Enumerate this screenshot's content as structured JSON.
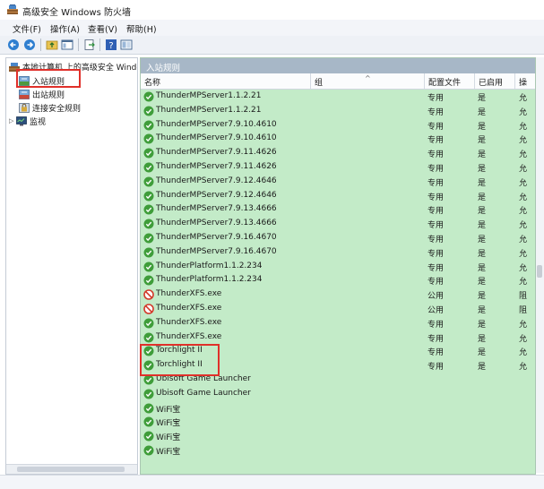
{
  "window": {
    "title": "高级安全 Windows 防火墙"
  },
  "menu": [
    "文件(F)",
    "操作(A)",
    "查看(V)",
    "帮助(H)"
  ],
  "toolbar_icons": [
    "back-arrow-icon",
    "forward-arrow-icon",
    "folder-up-icon",
    "panel-icon",
    "export-icon",
    "help-icon",
    "view-icon"
  ],
  "tree": {
    "root": "本地计算机 上的高级安全 Windows",
    "items": [
      "入站规则",
      "出站规则",
      "连接安全规则",
      "监视"
    ]
  },
  "section_header": "入站规则",
  "columns": {
    "name": "名称",
    "group": "组",
    "profile": "配置文件",
    "enabled": "已启用",
    "action": "操"
  },
  "rules": [
    {
      "name": "ThunderMPServer1.1.2.21",
      "profile": "专用",
      "enabled": "是",
      "action": "允",
      "icon": "allow"
    },
    {
      "name": "ThunderMPServer1.1.2.21",
      "profile": "专用",
      "enabled": "是",
      "action": "允",
      "icon": "allow"
    },
    {
      "name": "ThunderMPServer7.9.10.4610",
      "profile": "专用",
      "enabled": "是",
      "action": "允",
      "icon": "allow"
    },
    {
      "name": "ThunderMPServer7.9.10.4610",
      "profile": "专用",
      "enabled": "是",
      "action": "允",
      "icon": "allow"
    },
    {
      "name": "ThunderMPServer7.9.11.4626",
      "profile": "专用",
      "enabled": "是",
      "action": "允",
      "icon": "allow"
    },
    {
      "name": "ThunderMPServer7.9.11.4626",
      "profile": "专用",
      "enabled": "是",
      "action": "允",
      "icon": "allow"
    },
    {
      "name": "ThunderMPServer7.9.12.4646",
      "profile": "专用",
      "enabled": "是",
      "action": "允",
      "icon": "allow"
    },
    {
      "name": "ThunderMPServer7.9.12.4646",
      "profile": "专用",
      "enabled": "是",
      "action": "允",
      "icon": "allow"
    },
    {
      "name": "ThunderMPServer7.9.13.4666",
      "profile": "专用",
      "enabled": "是",
      "action": "允",
      "icon": "allow"
    },
    {
      "name": "ThunderMPServer7.9.13.4666",
      "profile": "专用",
      "enabled": "是",
      "action": "允",
      "icon": "allow"
    },
    {
      "name": "ThunderMPServer7.9.16.4670",
      "profile": "专用",
      "enabled": "是",
      "action": "允",
      "icon": "allow"
    },
    {
      "name": "ThunderMPServer7.9.16.4670",
      "profile": "专用",
      "enabled": "是",
      "action": "允",
      "icon": "allow"
    },
    {
      "name": "ThunderPlatform1.1.2.234",
      "profile": "专用",
      "enabled": "是",
      "action": "允",
      "icon": "allow"
    },
    {
      "name": "ThunderPlatform1.1.2.234",
      "profile": "专用",
      "enabled": "是",
      "action": "允",
      "icon": "allow"
    },
    {
      "name": "ThunderXFS.exe",
      "profile": "公用",
      "enabled": "是",
      "action": "阻",
      "icon": "block"
    },
    {
      "name": "ThunderXFS.exe",
      "profile": "公用",
      "enabled": "是",
      "action": "阻",
      "icon": "block"
    },
    {
      "name": "ThunderXFS.exe",
      "profile": "专用",
      "enabled": "是",
      "action": "允",
      "icon": "allow"
    },
    {
      "name": "ThunderXFS.exe",
      "profile": "专用",
      "enabled": "是",
      "action": "允",
      "icon": "allow"
    },
    {
      "name": "Torchlight II",
      "profile": "专用",
      "enabled": "是",
      "action": "允",
      "icon": "allow"
    },
    {
      "name": "Torchlight II",
      "profile": "专用",
      "enabled": "是",
      "action": "允",
      "icon": "allow"
    },
    {
      "name": "Ubisoft Game Launcher",
      "profile": "",
      "enabled": "",
      "action": "",
      "icon": "allow"
    },
    {
      "name": "Ubisoft Game Launcher",
      "profile": "",
      "enabled": "",
      "action": "",
      "icon": "allow"
    },
    {
      "name": "WiFi宝",
      "profile": "",
      "enabled": "",
      "action": "",
      "icon": "allow"
    },
    {
      "name": "WiFi宝",
      "profile": "",
      "enabled": "",
      "action": "",
      "icon": "allow"
    },
    {
      "name": "WiFi宝",
      "profile": "",
      "enabled": "",
      "action": "",
      "icon": "allow"
    },
    {
      "name": "WiFi宝",
      "profile": "",
      "enabled": "",
      "action": "",
      "icon": "allow"
    }
  ],
  "colors": {
    "allow": "#3f9d3a",
    "block": "#d23a2a",
    "highlight": "#e0302a",
    "header_bg": "#a7b7c7",
    "list_bg": "#c3ebc8"
  }
}
